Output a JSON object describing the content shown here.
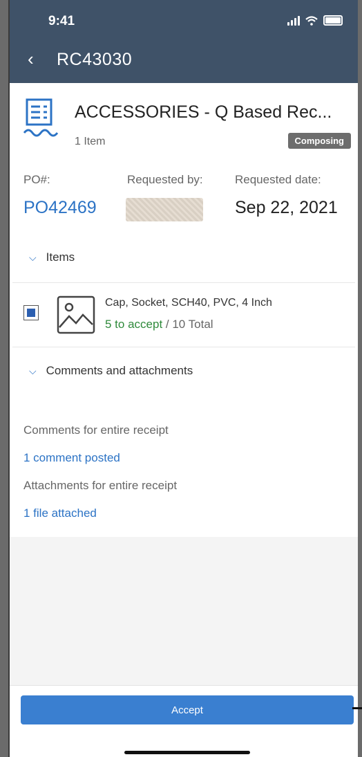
{
  "status_bar": {
    "time": "9:41"
  },
  "header": {
    "back_icon": "chevron-left-icon",
    "back": "‹",
    "title": "RC43030"
  },
  "document": {
    "icon": "receipt-icon",
    "title": "ACCESSORIES - Q Based Rec...",
    "item_count": "1 Item",
    "status_badge": "Composing"
  },
  "details": {
    "po_label": "PO#:",
    "po_number": "PO42469",
    "requested_by_label": "Requested by:",
    "requested_date_label": "Requested date:",
    "requested_date": "Sep 22, 2021"
  },
  "items_section": {
    "toggle_label": "Items",
    "chevron": "⌵",
    "items": [
      {
        "name": "Cap, Socket, SCH40, PVC, 4 Inch",
        "to_accept": "5 to accept",
        "separator": " / ",
        "total": "10 Total",
        "icon": "image-placeholder-icon"
      }
    ]
  },
  "comments_section": {
    "toggle_label": "Comments and attachments",
    "comments_label": "Comments for entire receipt",
    "comments_link": "1 comment posted",
    "attachments_label": "Attachments for entire receipt",
    "attachments_link": "1 file attached"
  },
  "footer": {
    "accept_label": "Accept"
  },
  "colors": {
    "header": "#3f5268",
    "link": "#2c73c5",
    "accept_green": "#2f8a3b",
    "primary_button": "#3a7fd0",
    "badge": "#6d6d6d"
  }
}
